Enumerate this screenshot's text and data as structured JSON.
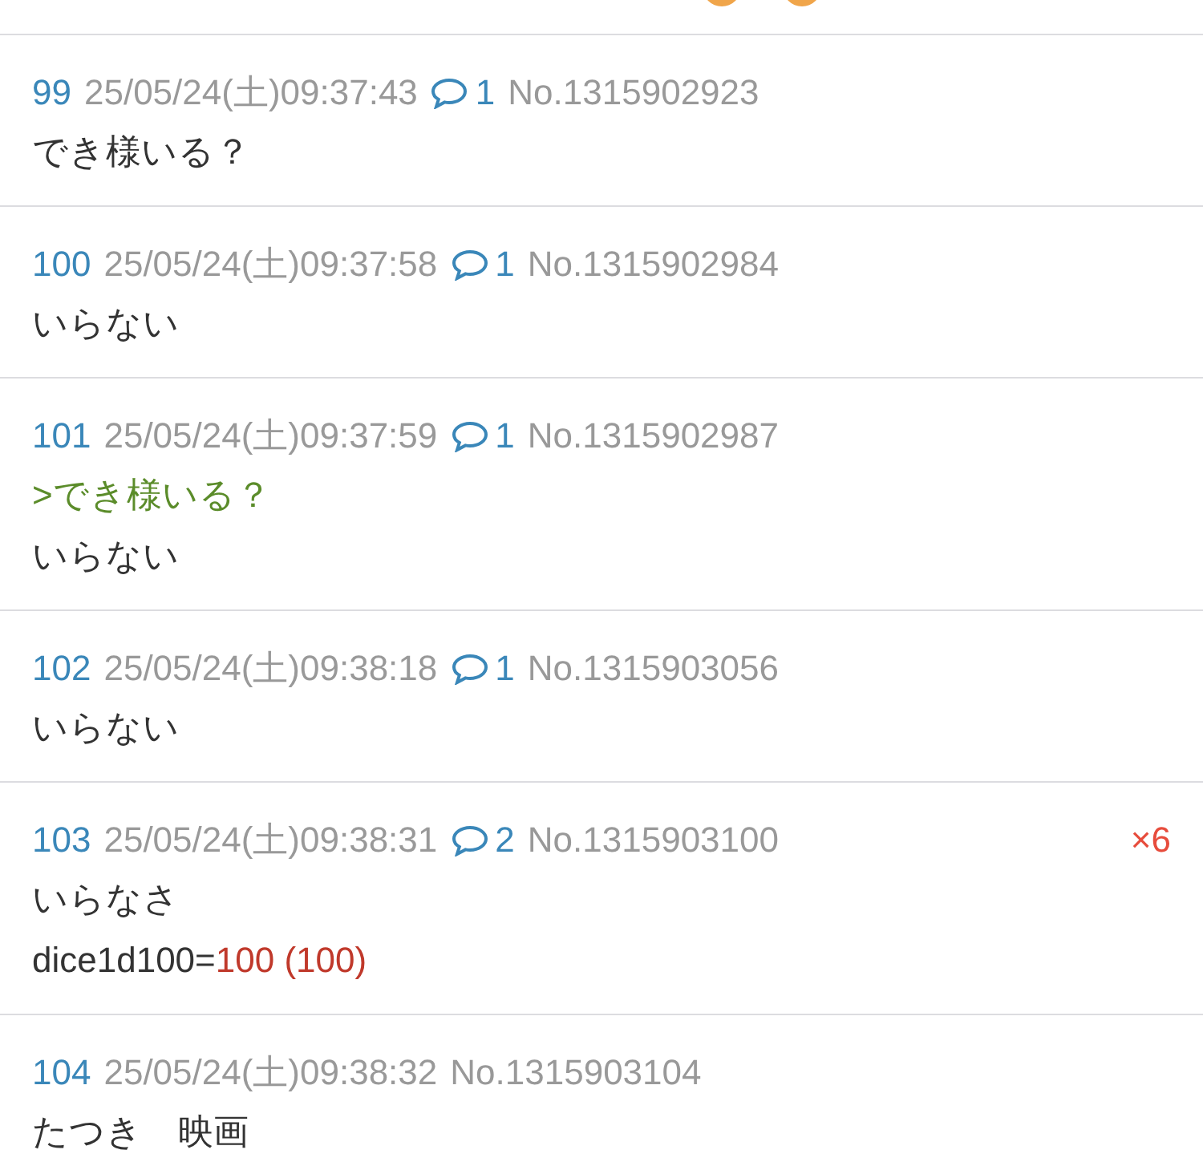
{
  "posts": [
    {
      "number": "99",
      "date": "25/05/24(土)09:37:43",
      "replies": "1",
      "post_no": "No.1315902923",
      "lines": [
        {
          "kind": "text",
          "text": "でき様いる？"
        }
      ]
    },
    {
      "number": "100",
      "date": "25/05/24(土)09:37:58",
      "replies": "1",
      "post_no": "No.1315902984",
      "lines": [
        {
          "kind": "text",
          "text": "いらない"
        }
      ]
    },
    {
      "number": "101",
      "date": "25/05/24(土)09:37:59",
      "replies": "1",
      "post_no": "No.1315902987",
      "lines": [
        {
          "kind": "quote",
          "text": ">でき様いる？"
        },
        {
          "kind": "text",
          "text": "いらない"
        }
      ]
    },
    {
      "number": "102",
      "date": "25/05/24(土)09:38:18",
      "replies": "1",
      "post_no": "No.1315903056",
      "lines": [
        {
          "kind": "text",
          "text": "いらない"
        }
      ]
    },
    {
      "number": "103",
      "date": "25/05/24(土)09:38:31",
      "replies": "2",
      "post_no": "No.1315903100",
      "likes": "×6",
      "lines": [
        {
          "kind": "text",
          "text": "いらなさ"
        },
        {
          "kind": "dice",
          "text": "dice1d100=",
          "result": "100 (100)"
        }
      ]
    },
    {
      "number": "104",
      "date": "25/05/24(土)09:38:32",
      "post_no": "No.1315903104",
      "lines": [
        {
          "kind": "text",
          "text": "たつき　映画"
        }
      ]
    }
  ]
}
